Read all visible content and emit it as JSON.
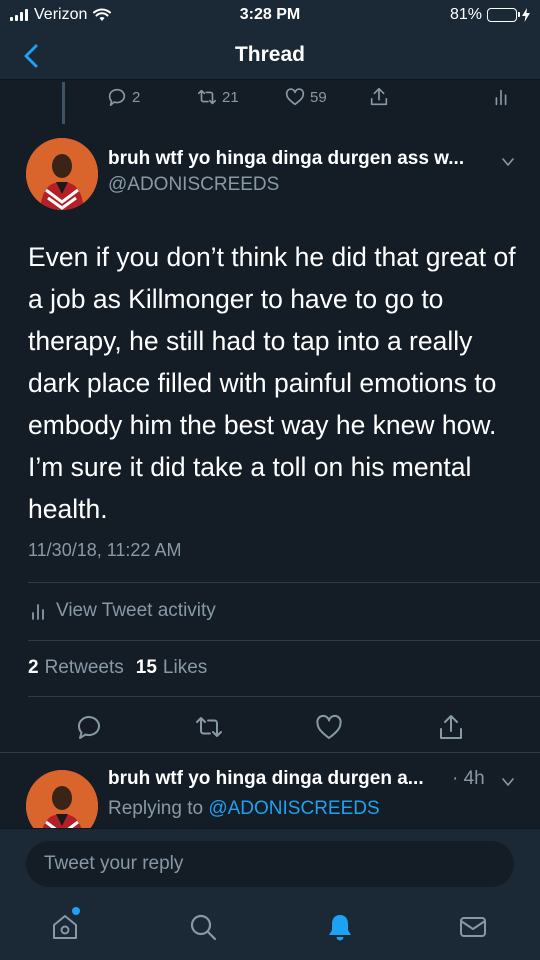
{
  "status_bar": {
    "carrier": "Verizon",
    "time": "3:28 PM",
    "battery": "81%"
  },
  "nav": {
    "title": "Thread"
  },
  "previous_tweet": {
    "replies": "2",
    "retweets": "21",
    "likes": "59"
  },
  "tweet": {
    "author_name": "bruh wtf yo hinga dinga durgen ass w...",
    "author_handle": "@ADONISCREEDS",
    "text": "Even if you don’t think he did that great of a job as Killmonger to have to go to therapy, he still had to tap into a really dark place filled with painful emotions to embody him the best way he knew how. I’m sure it did take a toll on his mental health.",
    "timestamp": "11/30/18, 11:22 AM",
    "activity_label": "View Tweet activity",
    "retweet_count": "2",
    "retweet_label": "Retweets",
    "like_count": "15",
    "like_label": "Likes"
  },
  "reply": {
    "author_name": "bruh wtf yo hinga dinga durgen a...",
    "time": "· 4h",
    "replying_prefix": "Replying to",
    "replying_handle": "@ADONISCREEDS"
  },
  "composer": {
    "placeholder": "Tweet your reply"
  },
  "colors": {
    "background": "#141d26",
    "bar": "#1b2836",
    "accent": "#1da1f2",
    "muted": "#8899a6"
  }
}
